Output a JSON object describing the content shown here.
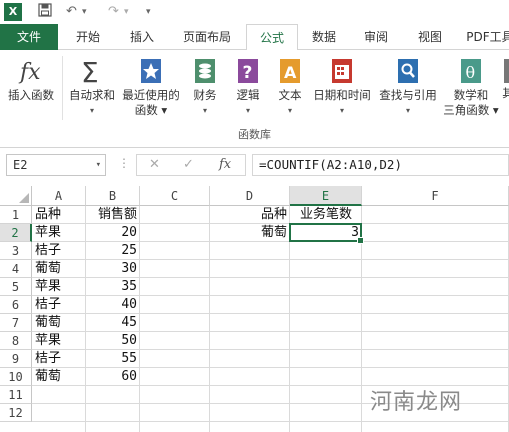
{
  "app": {
    "colors": {
      "brand": "#217346",
      "selection": "#217346"
    }
  },
  "quick_access": {
    "undo_glyph": "↶",
    "redo_glyph": "↷",
    "more_glyph": "▾",
    "excel_badge": "X"
  },
  "tabs": [
    "文件",
    "开始",
    "插入",
    "页面布局",
    "公式",
    "数据",
    "审阅",
    "视图",
    "PDF工具"
  ],
  "active_tab": "公式",
  "ribbon": {
    "buttons": [
      {
        "label1": "插入函数",
        "label2": "",
        "icon": "fx-icon"
      },
      {
        "label1": "自动求和",
        "label2": "▾",
        "icon": "sum-icon"
      },
      {
        "label1": "最近使用的",
        "label2": "函数 ▾",
        "icon": "star-book-icon"
      },
      {
        "label1": "财务",
        "label2": "▾",
        "icon": "coins-book-icon"
      },
      {
        "label1": "逻辑",
        "label2": "▾",
        "icon": "question-book-icon"
      },
      {
        "label1": "文本",
        "label2": "▾",
        "icon": "text-book-icon"
      },
      {
        "label1": "日期和时间",
        "label2": "▾",
        "icon": "calendar-book-icon"
      },
      {
        "label1": "查找与引用",
        "label2": "▾",
        "icon": "search-book-icon"
      },
      {
        "label1": "数学和",
        "label2": "三角函数 ▾",
        "icon": "theta-book-icon"
      },
      {
        "label1": "其",
        "label2": "",
        "icon": "more-book-icon"
      }
    ],
    "group_label": "函数库"
  },
  "formula_bar": {
    "name_box": "E2",
    "cancel": "✕",
    "enter": "✓",
    "fx": "fx",
    "formula": "=COUNTIF(A2:A10,D2)"
  },
  "sheet": {
    "columns": [
      "A",
      "B",
      "C",
      "D",
      "E",
      "F"
    ],
    "rows": [
      "1",
      "2",
      "3",
      "4",
      "5",
      "6",
      "7",
      "8",
      "9",
      "10",
      "11",
      "12"
    ],
    "selected_cell": "E2",
    "cells": {
      "A": [
        "品种",
        "苹果",
        "桔子",
        "葡萄",
        "苹果",
        "桔子",
        "葡萄",
        "苹果",
        "桔子",
        "葡萄"
      ],
      "B": [
        "销售额",
        "20",
        "25",
        "30",
        "35",
        "40",
        "45",
        "50",
        "55",
        "60"
      ],
      "D": [
        "品种",
        "葡萄"
      ],
      "E": [
        "业务笔数",
        "3"
      ]
    }
  },
  "watermark": "河南龙网"
}
